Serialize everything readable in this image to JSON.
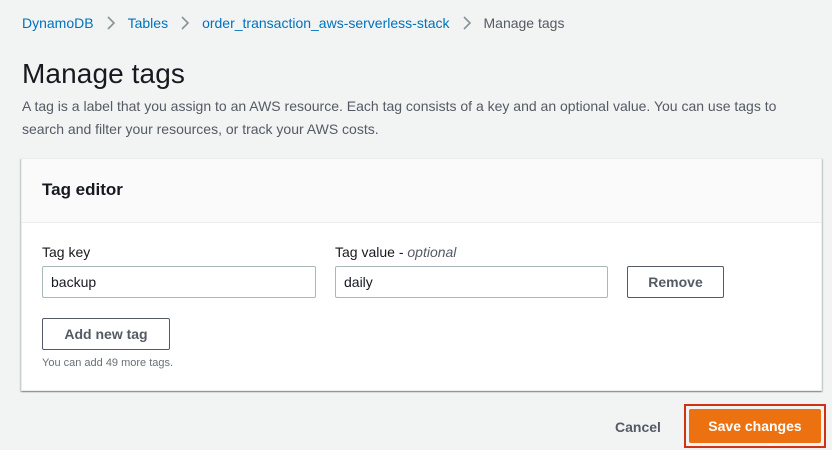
{
  "breadcrumb": {
    "items": [
      {
        "label": "DynamoDB"
      },
      {
        "label": "Tables"
      },
      {
        "label": "order_transaction_aws-serverless-stack"
      },
      {
        "label": "Manage tags"
      }
    ]
  },
  "page": {
    "title": "Manage tags",
    "description": "A tag is a label that you assign to an AWS resource. Each tag consists of a key and an optional value. You can use tags to search and filter your resources, or track your AWS costs."
  },
  "tag_editor": {
    "title": "Tag editor",
    "key_label": "Tag key",
    "value_label": "Tag value - ",
    "value_label_optional": "optional",
    "rows": [
      {
        "key": "backup",
        "value": "daily",
        "remove_label": "Remove"
      }
    ],
    "add_label": "Add new tag",
    "hint": "You can add 49 more tags."
  },
  "footer": {
    "cancel_label": "Cancel",
    "save_label": "Save changes"
  },
  "colors": {
    "link": "#0073bb",
    "primary": "#ec7211",
    "highlight_border": "#d13212"
  }
}
